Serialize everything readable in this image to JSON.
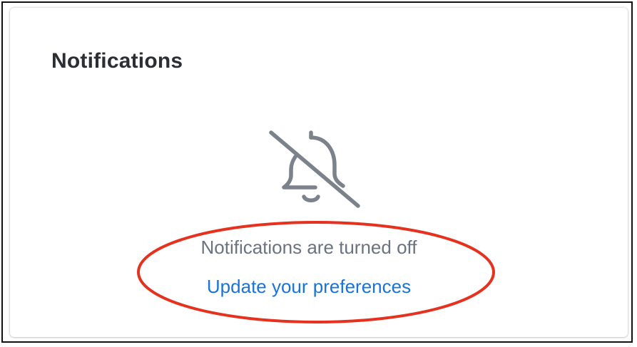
{
  "panel": {
    "title": "Notifications"
  },
  "empty_state": {
    "icon": "bell-off-icon",
    "message": "Notifications are turned off",
    "link_label": "Update your preferences"
  },
  "colors": {
    "title": "#2b2f33",
    "icon": "#7b828b",
    "message": "#6b7280",
    "link": "#1a73d9",
    "annotation": "#e5321f"
  }
}
